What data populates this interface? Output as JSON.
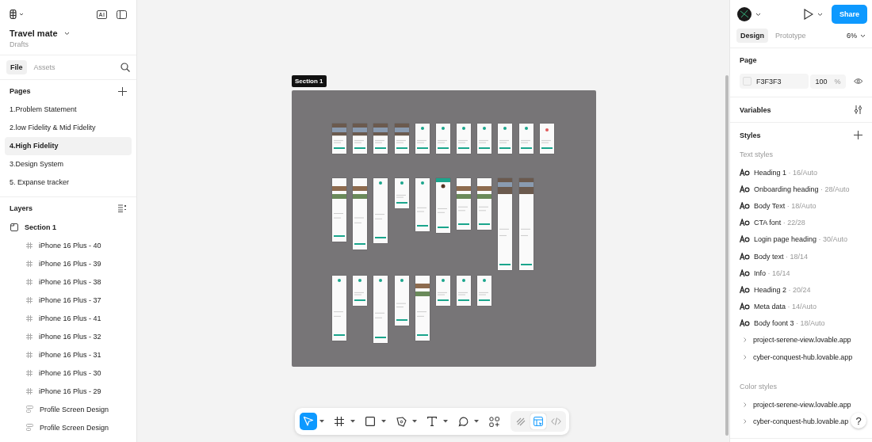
{
  "file": {
    "name": "Travel mate",
    "location": "Drafts"
  },
  "left_tabs": [
    {
      "label": "File",
      "selected": true
    },
    {
      "label": "Assets",
      "selected": false
    }
  ],
  "pages": {
    "title": "Pages",
    "items": [
      {
        "label": "1.Problem Statement",
        "selected": false
      },
      {
        "label": "2.low Fidelity & Mid Fidelity",
        "selected": false
      },
      {
        "label": "4.High Fidelity",
        "selected": true
      },
      {
        "label": "3.Design System",
        "selected": false
      },
      {
        "label": "5. Expanse tracker",
        "selected": false
      }
    ]
  },
  "layers": {
    "title": "Layers",
    "items": [
      {
        "label": "Section 1",
        "kind": "section",
        "children": [
          {
            "label": "iPhone 16 Plus - 40",
            "kind": "frame"
          },
          {
            "label": "iPhone 16 Plus - 39",
            "kind": "frame"
          },
          {
            "label": "iPhone 16 Plus - 38",
            "kind": "frame"
          },
          {
            "label": "iPhone 16 Plus - 37",
            "kind": "frame"
          },
          {
            "label": "iPhone 16 Plus - 41",
            "kind": "frame"
          },
          {
            "label": "iPhone 16 Plus - 32",
            "kind": "frame"
          },
          {
            "label": "iPhone 16 Plus - 31",
            "kind": "frame"
          },
          {
            "label": "iPhone 16 Plus - 30",
            "kind": "frame"
          },
          {
            "label": "iPhone 16 Plus - 29",
            "kind": "frame"
          },
          {
            "label": "Profile Screen Design",
            "kind": "layout"
          },
          {
            "label": "Profile Screen Design",
            "kind": "layout"
          }
        ]
      }
    ]
  },
  "canvas": {
    "section_label": "Section 1"
  },
  "right_tabs": [
    {
      "label": "Design",
      "selected": true
    },
    {
      "label": "Prototype",
      "selected": false
    }
  ],
  "zoom": "6%",
  "share": "Share",
  "page": {
    "title": "Page",
    "color": "F3F3F3",
    "opacity": "100",
    "unit": "%"
  },
  "variables": "Variables",
  "styles": {
    "title": "Styles",
    "text_title": "Text styles",
    "text_styles": [
      {
        "kind": "style",
        "name": "Heading 1",
        "meta": "· 16/Auto"
      },
      {
        "kind": "style",
        "name": "Onboarding heading",
        "meta": "· 28/Auto"
      },
      {
        "kind": "style",
        "name": "Body Text",
        "meta": "· 18/Auto"
      },
      {
        "kind": "style",
        "name": "CTA font",
        "meta": "· 22/28"
      },
      {
        "kind": "style",
        "name": "Login page heading",
        "meta": "· 30/Auto"
      },
      {
        "kind": "style",
        "name": "Body text",
        "meta": "· 18/14"
      },
      {
        "kind": "style",
        "name": "Info",
        "meta": "· 16/14"
      },
      {
        "kind": "style",
        "name": "Heading 2",
        "meta": "· 20/24"
      },
      {
        "kind": "style",
        "name": "Meta data",
        "meta": "· 14/Auto"
      },
      {
        "kind": "style",
        "name": "Body foont 3",
        "meta": "· 18/Auto"
      },
      {
        "kind": "group",
        "name": "project-serene-view.lovable.app"
      },
      {
        "kind": "group",
        "name": "cyber-conquest-hub.lovable.app"
      }
    ],
    "color_title": "Color styles",
    "color_styles": [
      {
        "kind": "group",
        "name": "project-serene-view.lovable.app"
      },
      {
        "kind": "group",
        "name": "cyber-conquest-hub.lovable.ap"
      }
    ]
  },
  "help": "?",
  "tools": [
    {
      "kind": "move",
      "selected": true
    },
    {
      "kind": "frame",
      "selected": false
    },
    {
      "kind": "shape",
      "selected": false
    },
    {
      "kind": "pen",
      "selected": false
    },
    {
      "kind": "text",
      "selected": false
    },
    {
      "kind": "comment",
      "selected": false
    },
    {
      "kind": "actions",
      "selected": false
    }
  ],
  "modes": [
    {
      "kind": "draw",
      "selected": false
    },
    {
      "kind": "design",
      "selected": true
    },
    {
      "kind": "dev",
      "selected": false
    }
  ]
}
